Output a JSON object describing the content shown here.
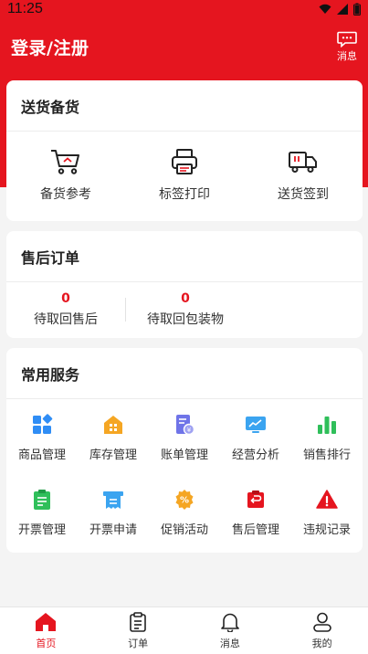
{
  "status_bar": {
    "time": "11:25"
  },
  "header": {
    "title": "登录/注册",
    "message_label": "消息"
  },
  "delivery": {
    "title": "送货备货",
    "items": [
      {
        "label": "备货参考",
        "icon": "cart-icon"
      },
      {
        "label": "标签打印",
        "icon": "printer-icon"
      },
      {
        "label": "送货签到",
        "icon": "truck-icon"
      }
    ]
  },
  "after_sales": {
    "title": "售后订单",
    "items": [
      {
        "count": "0",
        "label": "待取回售后"
      },
      {
        "count": "0",
        "label": "待取回包装物"
      }
    ]
  },
  "services": {
    "title": "常用服务",
    "items": [
      {
        "label": "商品管理",
        "icon": "grid-icon",
        "color": "#2f8df5"
      },
      {
        "label": "库存管理",
        "icon": "warehouse-icon",
        "color": "#f5a623"
      },
      {
        "label": "账单管理",
        "icon": "bill-icon",
        "color": "#6f74e8"
      },
      {
        "label": "经营分析",
        "icon": "monitor-chart-icon",
        "color": "#3ba4f0"
      },
      {
        "label": "销售排行",
        "icon": "bar-chart-icon",
        "color": "#2fbf5a"
      },
      {
        "label": "开票管理",
        "icon": "clipboard-icon",
        "color": "#2fbf5a"
      },
      {
        "label": "开票申请",
        "icon": "receipt-icon",
        "color": "#3ba4f0"
      },
      {
        "label": "促销活动",
        "icon": "promo-badge-icon",
        "color": "#f5a623"
      },
      {
        "label": "售后管理",
        "icon": "return-icon",
        "color": "#e5151f"
      },
      {
        "label": "违规记录",
        "icon": "warning-icon",
        "color": "#e5151f"
      }
    ]
  },
  "tabbar": {
    "items": [
      {
        "label": "首页",
        "icon": "home-icon",
        "active": true
      },
      {
        "label": "订单",
        "icon": "order-list-icon",
        "active": false
      },
      {
        "label": "消息",
        "icon": "bell-icon",
        "active": false
      },
      {
        "label": "我的",
        "icon": "user-icon",
        "active": false
      }
    ]
  },
  "colors": {
    "brand": "#e5151f",
    "background": "#f4f4f4"
  }
}
